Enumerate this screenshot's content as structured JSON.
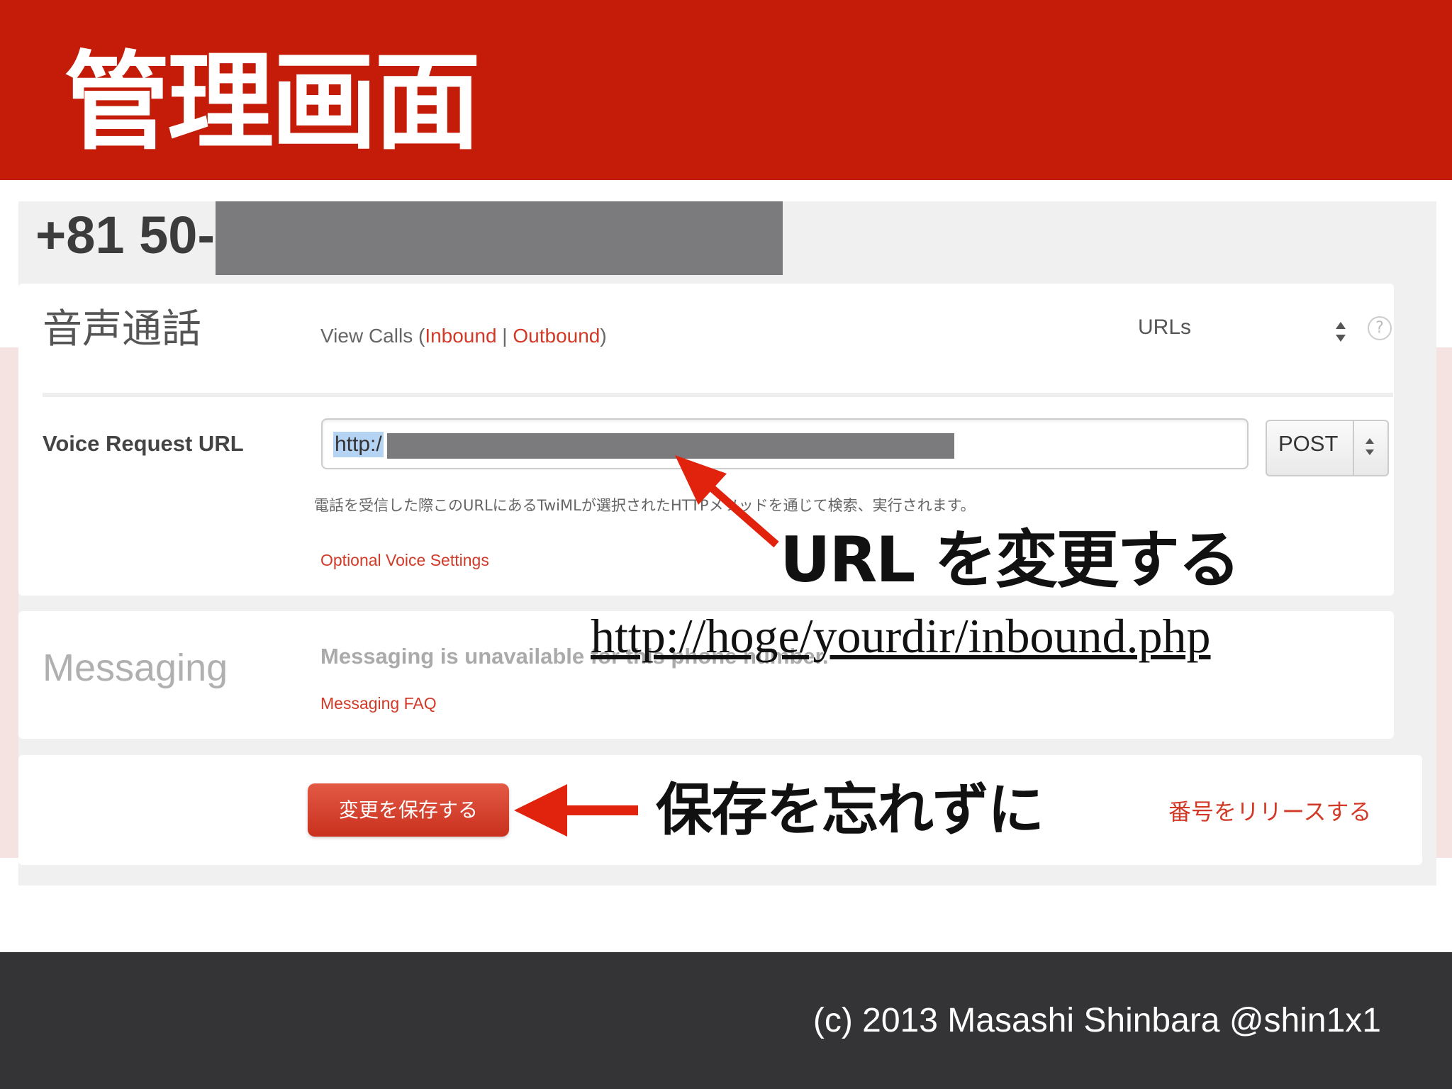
{
  "slide": {
    "title": "管理画面",
    "credit": "(c) 2013 Masashi Shinbara @shin1x1"
  },
  "phone": {
    "number_prefix": "+81 50-"
  },
  "voice": {
    "section_title": "音声通話",
    "view_calls_prefix": "View Calls (",
    "inbound_link": "Inbound",
    "separator": " | ",
    "outbound_link": "Outbound",
    "view_calls_suffix": ")",
    "urls_label": "URLs",
    "help_icon": "?",
    "request_url_label": "Voice Request URL",
    "request_url_value": "http:/",
    "method": "POST",
    "help_text": "電話を受信した際このURLにあるTwiMLが選択されたHTTPメソッドを通じて検索、実行されます。",
    "optional_settings_link": "Optional Voice Settings"
  },
  "messaging": {
    "section_title": "Messaging",
    "unavailable_text": "Messaging is unavailable for this phone number.",
    "faq_link": "Messaging FAQ"
  },
  "actions": {
    "save_button": "変更を保存する",
    "release_link": "番号をリリースする"
  },
  "annotations": {
    "change_url": "URL を変更する",
    "example_url": "http://hoge/yourdir/inbound.php",
    "dont_forget_save": "保存を忘れずに",
    "arrow_color": "#e1220d"
  },
  "colors": {
    "title_bar": "#c51c0a",
    "footer_bar": "#343335",
    "link_red": "#d23a27",
    "redaction": "#7b7a7d"
  }
}
